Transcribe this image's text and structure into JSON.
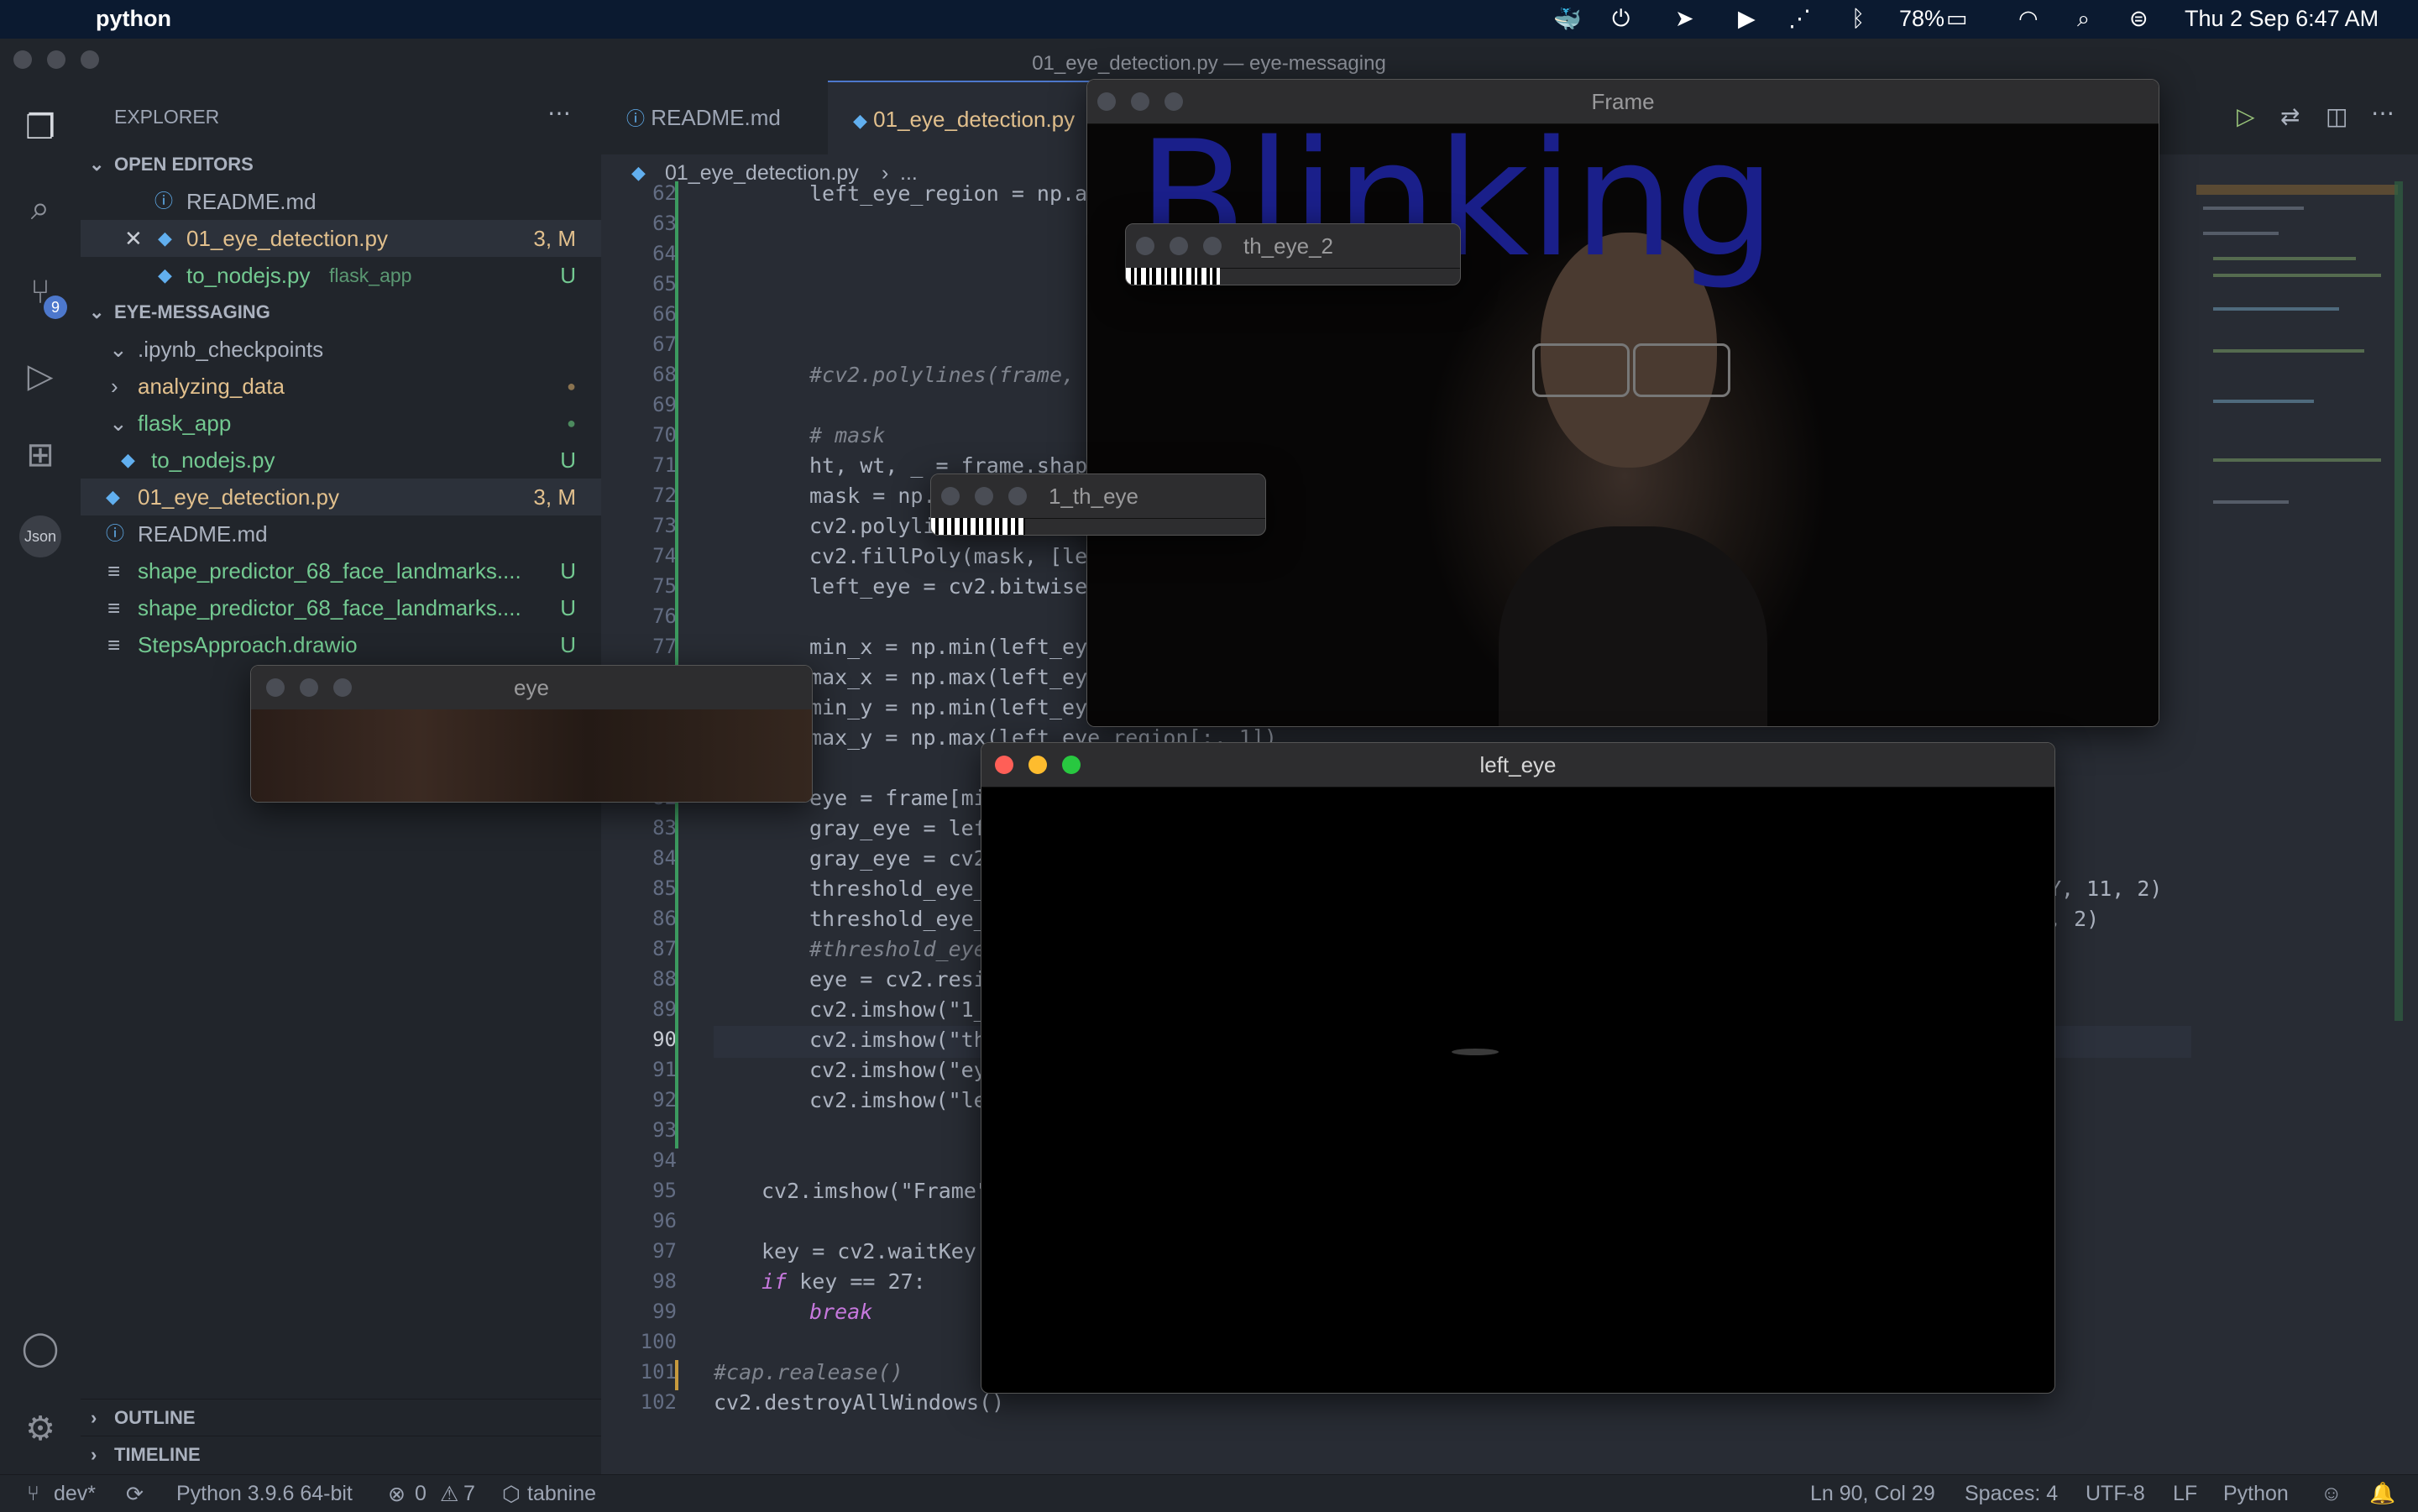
{
  "menubar": {
    "app": "python",
    "battery": "78%",
    "datetime": "Thu 2 Sep  6:47 AM"
  },
  "window": {
    "title": "01_eye_detection.py — eye-messaging"
  },
  "activity": {
    "scm_badge": "9",
    "json_label": "Json"
  },
  "sidebar": {
    "title": "EXPLORER",
    "open_editors_header": "OPEN EDITORS",
    "open_editors": [
      {
        "name": "README.md",
        "badge": ""
      },
      {
        "name": "01_eye_detection.py",
        "badge": "3, M"
      },
      {
        "name": "to_nodejs.py",
        "hint": "flask_app",
        "badge": "U"
      }
    ],
    "project_header": "EYE-MESSAGING",
    "tree": [
      {
        "name": ".ipynb_checkpoints",
        "badge": ""
      },
      {
        "name": "analyzing_data",
        "badge": "●"
      },
      {
        "name": "flask_app",
        "badge": "●"
      },
      {
        "name": "to_nodejs.py",
        "badge": "U"
      },
      {
        "name": "01_eye_detection.py",
        "badge": "3, M"
      },
      {
        "name": "README.md",
        "badge": ""
      },
      {
        "name": "shape_predictor_68_face_landmarks....",
        "badge": "U"
      },
      {
        "name": "shape_predictor_68_face_landmarks....",
        "badge": "U"
      },
      {
        "name": "StepsApproach.drawio",
        "badge": "U"
      }
    ],
    "outline": "OUTLINE",
    "timeline": "TIMELINE"
  },
  "tabs": [
    {
      "label": "README.md"
    },
    {
      "label": "01_eye_detection.py"
    }
  ],
  "breadcrumb": {
    "file": "01_eye_detection.py",
    "rest": "..."
  },
  "code": {
    "line_numbers": [
      "62",
      "63",
      "64",
      "65",
      "66",
      "67",
      "68",
      "69",
      "70",
      "71",
      "72",
      "73",
      "74",
      "75",
      "76",
      "77",
      "78",
      "79",
      "80",
      "81",
      "82",
      "83",
      "84",
      "85",
      "86",
      "87",
      "88",
      "89",
      "90",
      "91",
      "92",
      "93",
      "94",
      "95",
      "96",
      "97",
      "98",
      "99",
      "100",
      "101",
      "102"
    ],
    "lines": {
      "l62": "left_eye_region = np.ar",
      "l68": "#cv2.polylines(frame, [",
      "l70": "# mask",
      "l71": "ht, wt, _ = frame.shape",
      "l72": "mask = np.",
      "l73": "cv2.polyli",
      "l74": "cv2.fillPoly(mask, [lef",
      "l75": "left_eye = cv2.bitwise_",
      "l77": "min_x = np.min(left_eye",
      "l78": "max_x = np.max(left_eye",
      "l79": "min_y = np.min(left_eye",
      "l80": "max_y = np.max(left_eye_region[:, 1])",
      "l82": "eye = frame[mi",
      "l83": "gray_eye = lef",
      "l84": "gray_eye = cv2",
      "l85": "threshold_eye_",
      "l85b": "Y, 11, 2)",
      "l86": "threshold_eye_",
      "l86b": ", 2)",
      "l87": "#threshold_eye",
      "l88": "eye = cv2.resi",
      "l89": "cv2.imshow(\"1_",
      "l90": "cv2.imshow(\"th",
      "l91": "cv2.imshow(\"ey",
      "l92": "cv2.imshow(\"le",
      "l95": "cv2.imshow(\"Frame\"",
      "l97": "key = cv2.waitKey(",
      "l98a": "if",
      "l98b": " key == 27:",
      "l99": "break",
      "l101": "#cap.realease()",
      "l102": "cv2.destroyAllWindows()"
    }
  },
  "cv_windows": {
    "frame": {
      "title": "Frame",
      "overlay_text": "Blinking"
    },
    "th_eye_2": {
      "title": "th_eye_2"
    },
    "th_eye_1": {
      "title": "1_th_eye"
    },
    "eye": {
      "title": "eye"
    },
    "left_eye": {
      "title": "left_eye"
    }
  },
  "statusbar": {
    "branch": "dev*",
    "interpreter": "Python 3.9.6 64-bit",
    "errors": "0",
    "warnings": "7",
    "tabnine": "tabnine",
    "position": "Ln 90, Col 29",
    "spaces": "Spaces: 4",
    "encoding": "UTF-8",
    "eol": "LF",
    "language": "Python"
  },
  "colors": {
    "accent": "#4d78cc",
    "modified": "#e2c08d",
    "untracked": "#73c991",
    "tl_close": "#ff5f57",
    "tl_min": "#febc2e",
    "tl_max": "#28c840"
  }
}
